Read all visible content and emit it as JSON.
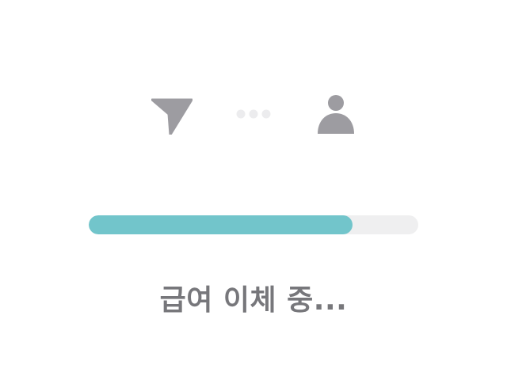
{
  "transfer": {
    "source_icon": "send-arrow-icon",
    "connector_icon": "dots-icon",
    "destination_icon": "person-icon",
    "icon_color": "#9d9ca1",
    "dots_color": "#ececee"
  },
  "progress": {
    "fraction": 0.8,
    "fill_color": "#72c5cb",
    "track_color": "#efeff0"
  },
  "status": {
    "label": "급여 이체 중..."
  }
}
